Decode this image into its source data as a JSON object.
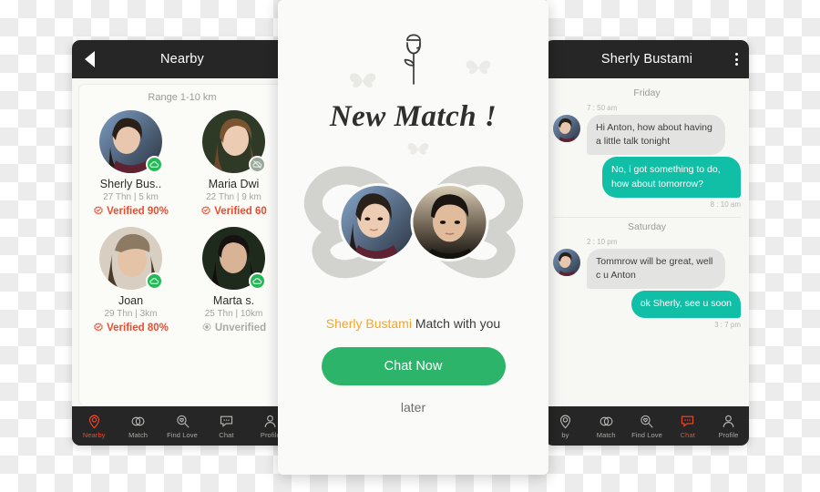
{
  "colors": {
    "accent_orange": "#f0492a",
    "teal_bubble": "#10bfa5",
    "green_button": "#2cb46a",
    "name_amber": "#f5a623",
    "appbar_dark": "#262626"
  },
  "left_phone": {
    "appbar": {
      "title": "Nearby",
      "back_icon": "back-arrow-icon"
    },
    "range_label": "Range 1-10 km",
    "people": [
      {
        "name": "Sherly Bus..",
        "meta": "27 Thn | 5 km",
        "verify_text": "Verified 90%",
        "verified": true,
        "status": "online"
      },
      {
        "name": "Maria Dwi",
        "meta": "22 Thn | 9 km",
        "verify_text": "Verified 60",
        "verified": true,
        "status": "offline"
      },
      {
        "name": "Joan",
        "meta": "29 Thn | 3km",
        "verify_text": "Verified 80%",
        "verified": true,
        "status": "online"
      },
      {
        "name": "Marta s.",
        "meta": "25 Thn | 10km",
        "verify_text": "Unverified",
        "verified": false,
        "status": "online"
      }
    ],
    "nav": [
      {
        "label": "Nearby",
        "icon": "location-pin-icon",
        "active": true
      },
      {
        "label": "Match",
        "icon": "two-rings-icon",
        "active": false
      },
      {
        "label": "Find Love",
        "icon": "search-heart-icon",
        "active": false
      },
      {
        "label": "Chat",
        "icon": "chat-bubble-icon",
        "active": false
      },
      {
        "label": "Profile",
        "icon": "person-icon",
        "active": false
      }
    ]
  },
  "right_phone": {
    "appbar": {
      "title": "Sherly Bustami",
      "menu_icon": "kebab-menu-icon"
    },
    "conversation": [
      {
        "day": "Friday",
        "messages": [
          {
            "direction": "in",
            "time": "7 : 50 am",
            "text": "Hi Anton, how about having a little talk tonight"
          },
          {
            "direction": "out",
            "time": "8 : 10 am",
            "text": "No, i got something to do, how about tomorrow?"
          }
        ]
      },
      {
        "day": "Saturday",
        "messages": [
          {
            "direction": "in",
            "time": "2 : 10 pm",
            "text": "Tommrow will be great, well c u Anton"
          },
          {
            "direction": "out",
            "time": "3 : 7 pm",
            "text": "ok  Sherly, see u soon"
          }
        ]
      }
    ],
    "nav": [
      {
        "label": "by",
        "icon": "location-pin-icon",
        "active": false
      },
      {
        "label": "Match",
        "icon": "two-rings-icon",
        "active": false
      },
      {
        "label": "Find Love",
        "icon": "search-heart-icon",
        "active": false
      },
      {
        "label": "Chat",
        "icon": "chat-bubble-icon",
        "active": true
      },
      {
        "label": "Profile",
        "icon": "person-icon",
        "active": false
      }
    ]
  },
  "modal": {
    "rose_icon": "rose-flower-icon",
    "butterfly_icon": "butterfly-icon",
    "title": "New Match !",
    "match_name": "Sherly Bustami",
    "match_rest": " Match with you",
    "primary_button": "Chat Now",
    "secondary_button": "later"
  }
}
